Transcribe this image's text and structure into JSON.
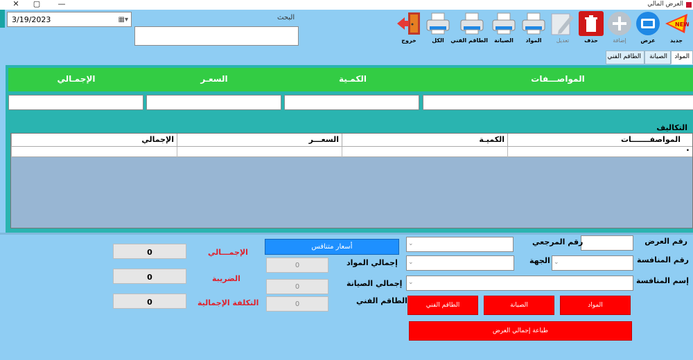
{
  "window": {
    "title": "العرض المالي",
    "close": "✕",
    "maximize": "▢",
    "minimize": "—"
  },
  "date": "3/19/2023",
  "search": {
    "label": "البحث",
    "value": ""
  },
  "toolbar": [
    {
      "label": "جديد",
      "icon": "new-badge-icon"
    },
    {
      "label": "عرض",
      "icon": "tv-icon"
    },
    {
      "label": "إضافة",
      "icon": "plus-circle-icon"
    },
    {
      "label": "حذف",
      "icon": "trash-icon"
    },
    {
      "label": "تعديل",
      "icon": "pencil-icon"
    },
    {
      "label": "المواد",
      "icon": "printer-icon"
    },
    {
      "label": "الصيانة",
      "icon": "printer-icon"
    },
    {
      "label": "الطاقم الفني",
      "icon": "printer-icon"
    },
    {
      "label": "الكل",
      "icon": "printer-icon"
    },
    {
      "label": "خروج",
      "icon": "exit-door-icon"
    }
  ],
  "tabs": [
    "المواد",
    "الصيانة",
    "الطاقم الفني"
  ],
  "entry": {
    "headers": [
      "المواصـــفات",
      "الكمـية",
      "السعـر",
      "الإجمـالي"
    ]
  },
  "costs": {
    "title": "التكاليف",
    "columns": [
      "المواصفـــــــات",
      "الكميـة",
      "السعـــر",
      "الإجمالي"
    ],
    "row_marker": "•"
  },
  "form": {
    "offer_no": "رقم العرض",
    "ref_no": "رقم المرجعي",
    "tender_no": "رقم المنافسة",
    "party": "الجهة",
    "tender_name": "إسم المنافسة",
    "competitor_prices": "أسعار متنافس",
    "materials_total": "إجمالي المواد",
    "maintenance_total": "إجمالي الصيانة",
    "tech_staff": "الطاقم الفني",
    "materials_total_value": "0",
    "maintenance_total_value": "0",
    "tech_staff_value": "0",
    "btn_materials": "المواد",
    "btn_maintenance": "الصيانة",
    "btn_tech_staff": "الطاقم الفني",
    "btn_print_total": "طباعة إجمالي العرض"
  },
  "totals": {
    "total_label": "الإجمـــالي",
    "tax_label": "الضريبة",
    "grand_label": "التكلفة الإجمالية",
    "total_value": "0",
    "tax_value": "0",
    "grand_value": "0"
  },
  "colors": {
    "background": "#8fcdf3",
    "header_green": "#33cc44",
    "teal": "#2ab4b0",
    "red": "#ff0000",
    "blue": "#1e90ff"
  }
}
